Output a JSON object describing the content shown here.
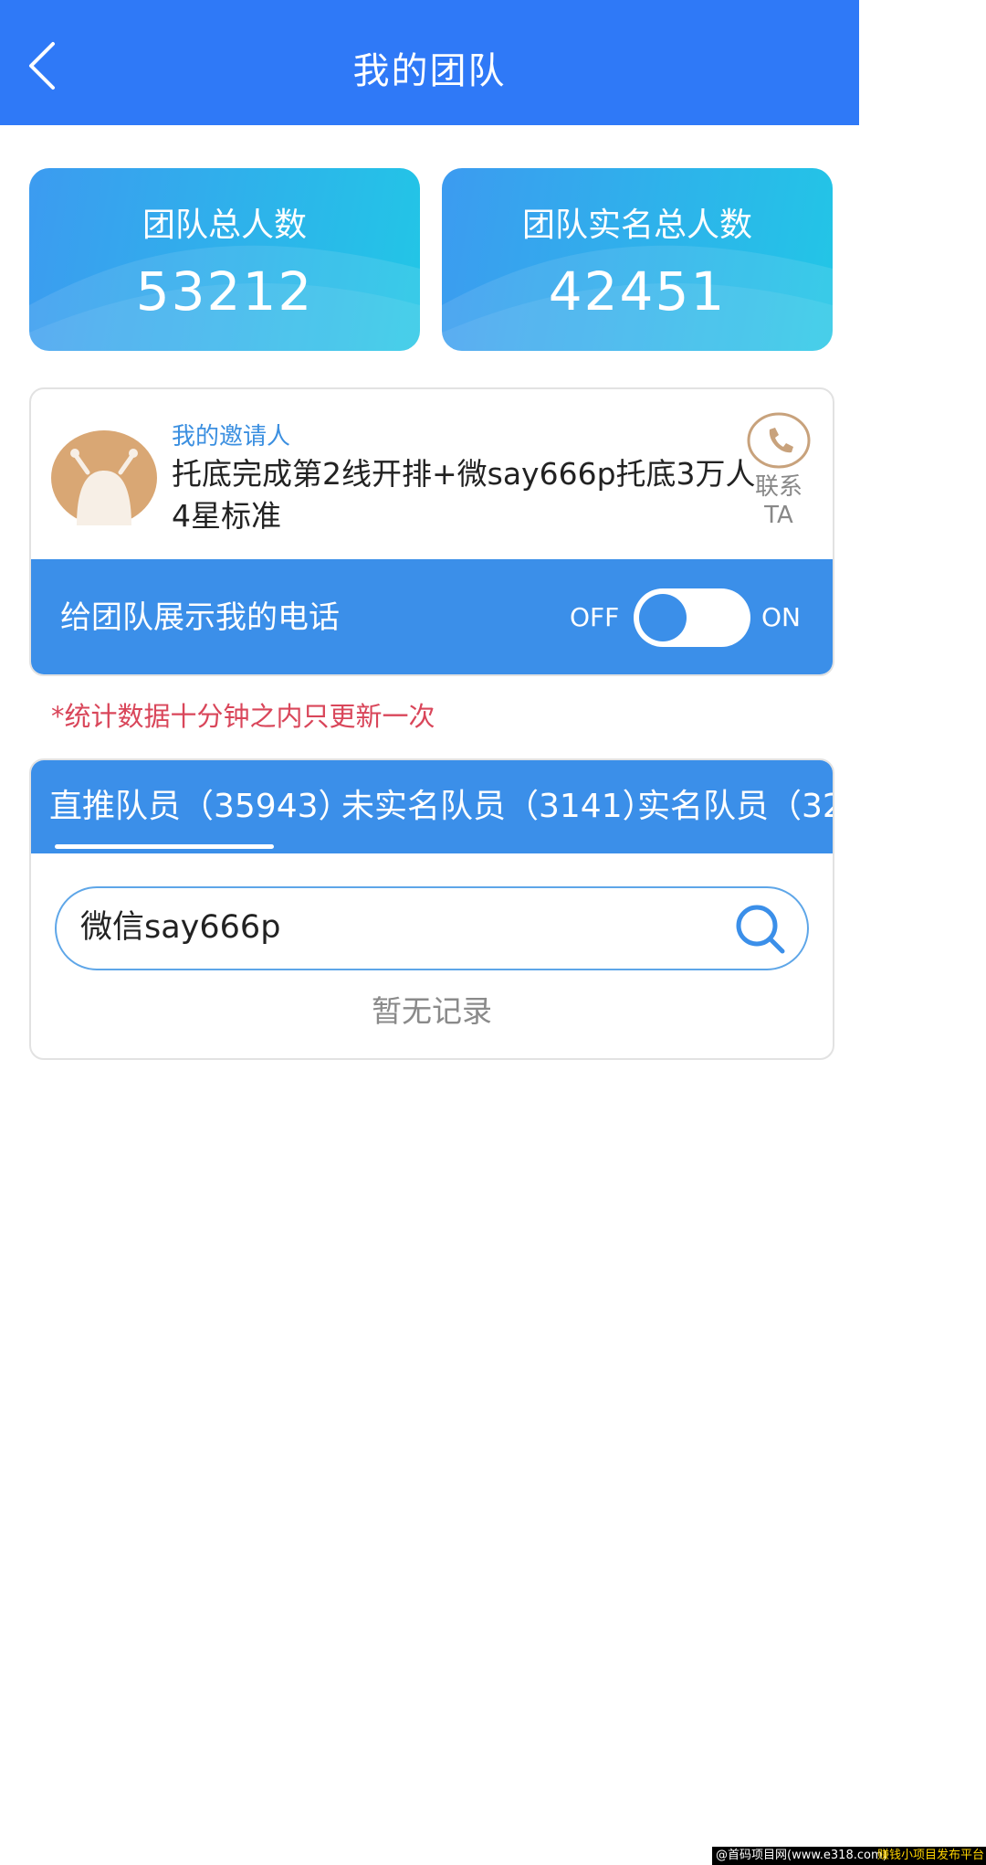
{
  "header": {
    "title": "我的团队",
    "back_icon": "chevron-left-icon"
  },
  "stats": [
    {
      "label": "团队总人数",
      "value": "53212"
    },
    {
      "label": "团队实名总人数",
      "value": "42451"
    }
  ],
  "inviter": {
    "label": "我的邀请人",
    "name": "托底完成第2线开排+微say666p托底3万人4星标准",
    "contact_label": "联系TA",
    "contact_icon": "phone-icon",
    "avatar_icon": "avatar-image"
  },
  "phone_display": {
    "label": "给团队展示我的电话",
    "off_label": "OFF",
    "on_label": "ON",
    "state": "OFF"
  },
  "notice": "*统计数据十分钟之内只更新一次",
  "tabs": [
    {
      "label": "直推队员（35943）",
      "active": true
    },
    {
      "label": "未实名队员（3141）",
      "active": false
    },
    {
      "label": "实名队员（32",
      "active": false
    }
  ],
  "search": {
    "value": "微信say666p",
    "icon": "search-icon"
  },
  "empty_text": "暂无记录",
  "watermark": {
    "left": "@首码项目网(www.e318.com)",
    "right": "赚钱小项目发布平台"
  },
  "colors": {
    "header_bg": "#2f79f7",
    "bar_bg": "#3b8fe9",
    "notice": "#d9465a"
  }
}
